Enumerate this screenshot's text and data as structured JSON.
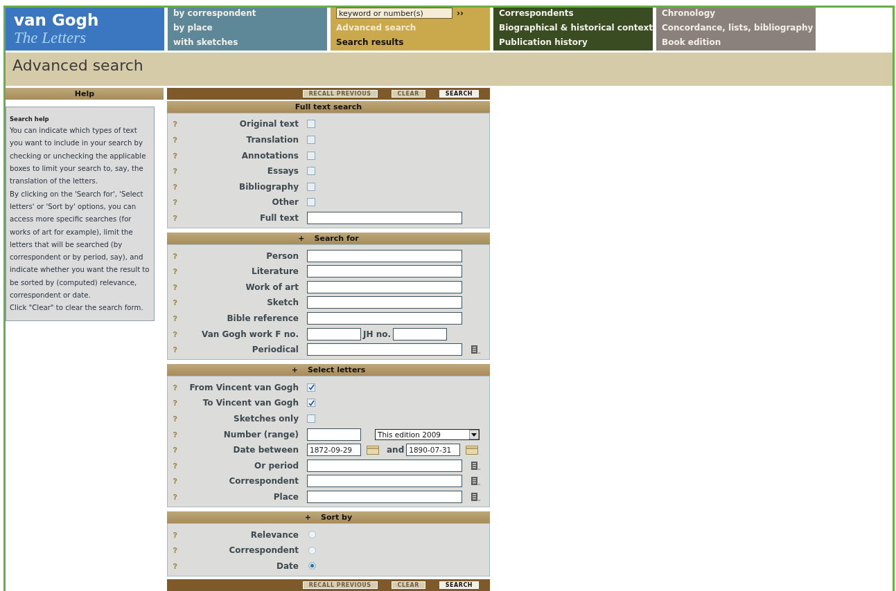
{
  "logo": {
    "title": "van Gogh",
    "subtitle": "The Letters"
  },
  "nav": [
    {
      "color": "#5e8898",
      "items": [
        {
          "label": "by correspondent",
          "selected": false
        },
        {
          "label": "by place",
          "selected": false
        },
        {
          "label": "with sketches",
          "selected": false
        }
      ]
    },
    {
      "color": "#c9a94c",
      "search": {
        "value": "keyword or number(s)",
        "go": "››"
      },
      "items": [
        {
          "label": "Advanced search",
          "selected": true
        },
        {
          "label": "Search results",
          "selected": false
        }
      ]
    },
    {
      "color": "#3a4d22",
      "items": [
        {
          "label": "Correspondents",
          "selected": false
        },
        {
          "label": "Biographical & historical context",
          "selected": false
        },
        {
          "label": "Publication history",
          "selected": false
        }
      ]
    },
    {
      "color": "#8a817d",
      "items": [
        {
          "label": "Chronology",
          "selected": false
        },
        {
          "label": "Concordance, lists, bibliography",
          "selected": false
        },
        {
          "label": "Book edition",
          "selected": false
        }
      ]
    }
  ],
  "page_title": "Advanced search",
  "help": {
    "header": "Help",
    "title": "Search help",
    "paragraphs": [
      "You can indicate which types of text you want to include in your search by checking or unchecking the applicable boxes to limit your search to, say, the translation of the letters.",
      "By clicking on the 'Search for', 'Select letters' or 'Sort by' options, you can access more specific searches (for works of art for example), limit the letters that will be searched (by correspondent or by period, say), and indicate whether you want the result to be sorted by (computed) relevance, correspondent or date.",
      "Click \"Clear\" to clear the search form."
    ]
  },
  "top_toolbar": [
    {
      "label": "RECALL PREVIOUS",
      "disabled": true
    },
    {
      "label": "CLEAR",
      "disabled": true
    },
    {
      "label": "SEARCH",
      "disabled": false
    }
  ],
  "sections": [
    {
      "title": "Full text search",
      "rows": [
        {
          "kind": "checkbox",
          "label": "Original text",
          "checked": false
        },
        {
          "kind": "checkbox",
          "label": "Translation",
          "checked": false
        },
        {
          "kind": "checkbox",
          "label": "Annotations",
          "checked": false
        },
        {
          "kind": "checkbox",
          "label": "Essays",
          "checked": false
        },
        {
          "kind": "checkbox",
          "label": "Bibliography",
          "checked": false
        },
        {
          "kind": "checkbox",
          "label": "Other",
          "checked": false
        },
        {
          "kind": "text",
          "label": "Full text"
        }
      ]
    },
    {
      "title": "Search for",
      "toggle": "+",
      "rows": [
        {
          "kind": "text",
          "label": "Person"
        },
        {
          "kind": "text",
          "label": "Literature"
        },
        {
          "kind": "text",
          "label": "Work of art"
        },
        {
          "kind": "text",
          "label": "Sketch"
        },
        {
          "kind": "text",
          "label": "Bible reference"
        },
        {
          "kind": "pair",
          "label": "Van Gogh work F no.",
          "second_label": "JH no."
        },
        {
          "kind": "lookup",
          "label": "Periodical"
        }
      ]
    },
    {
      "title": "Select letters",
      "toggle": "+",
      "rows": [
        {
          "kind": "checkbox",
          "label": "From Vincent van Gogh",
          "checked": true
        },
        {
          "kind": "checkbox",
          "label": "To Vincent van Gogh",
          "checked": true
        },
        {
          "kind": "checkbox",
          "label": "Sketches only",
          "checked": false
        },
        {
          "kind": "range",
          "label": "Number (range)",
          "option": "This edition 2009"
        },
        {
          "kind": "dates",
          "label": "Date between",
          "from": "1872-09-29",
          "joiner": "and",
          "to": "1890-07-31"
        },
        {
          "kind": "lookup",
          "label": "Or period"
        },
        {
          "kind": "lookup",
          "label": "Correspondent"
        },
        {
          "kind": "lookup",
          "label": "Place"
        }
      ]
    },
    {
      "title": "Sort by",
      "toggle": "+",
      "rows": [
        {
          "kind": "radio",
          "label": "Relevance",
          "selected": false
        },
        {
          "kind": "radio",
          "label": "Correspondent",
          "selected": false
        },
        {
          "kind": "radio",
          "label": "Date",
          "selected": true
        }
      ]
    }
  ],
  "bottom_toolbar": [
    {
      "label": "RECALL PREVIOUS",
      "disabled": true
    },
    {
      "label": "CLEAR",
      "disabled": true
    },
    {
      "label": "SEARCH",
      "disabled": false
    }
  ]
}
